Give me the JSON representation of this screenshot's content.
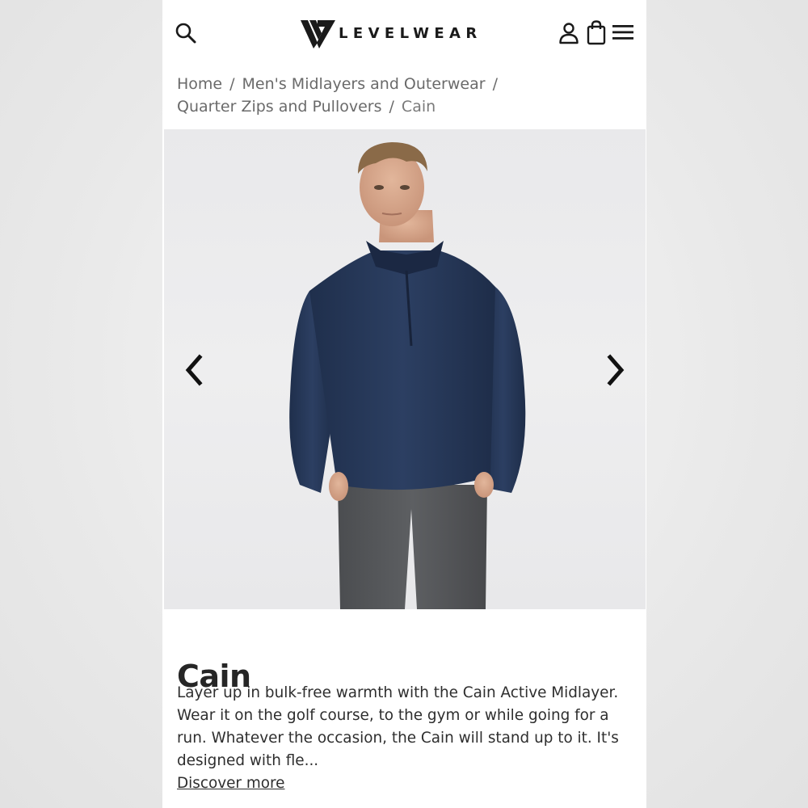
{
  "header": {
    "brand": "LEVELWEAR",
    "icons": {
      "search": "search-icon",
      "account": "user-icon",
      "bag": "shopping-bag-icon",
      "menu": "hamburger-menu-icon"
    }
  },
  "breadcrumb": {
    "items": [
      "Home",
      "Men's Midlayers and Outerwear",
      "Quarter Zips and Pullovers",
      "Cain"
    ],
    "separator": "/"
  },
  "gallery": {
    "prev_icon": "chevron-left-icon",
    "next_icon": "chevron-right-icon"
  },
  "product": {
    "name": "Cain",
    "description": "Layer up in bulk-free warmth with the Cain Active Midlayer. Wear it on the golf course, to the gym or while going for a run. Whatever the occasion, the Cain will stand up to it. It's designed with fle...",
    "discover_label": "Discover more"
  },
  "colors": {
    "page_bg": "#ececec",
    "panel_bg": "#ffffff",
    "text_dark": "#2e2e2e",
    "text_muted": "#6a6a6a",
    "garment_navy": "#283a5a",
    "pants_grey": "#555759"
  }
}
